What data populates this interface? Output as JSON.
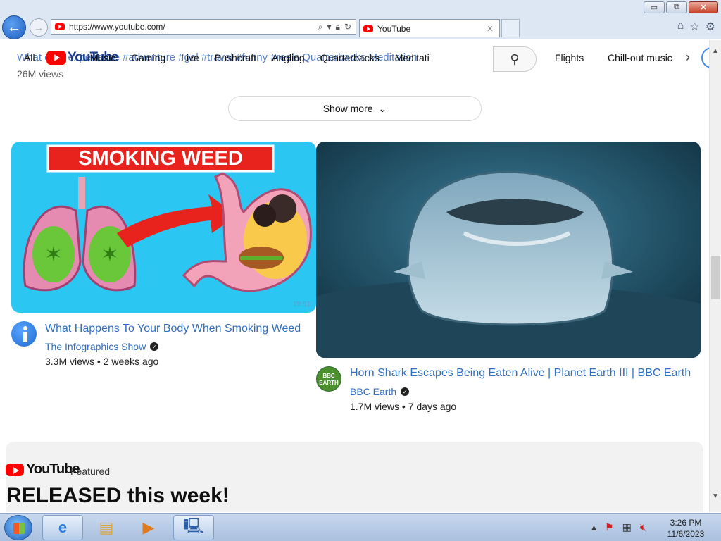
{
  "browser": {
    "url": "https://www.youtube.com/",
    "tab_title": "YouTube",
    "window_buttons": {
      "minimize": "▭",
      "restore": "⧉",
      "close": "✕"
    }
  },
  "header": {
    "logo_text": "YouTube",
    "overlap_text": "What   ever experience #adventure #gol #travel #funny #reels Quarterbacks Meditation",
    "chips": [
      "All",
      "Music",
      "Gaming",
      "Live",
      "Bushcraft",
      "Angling",
      "Quarterbacks",
      "Meditati"
    ],
    "chips_right": [
      "Flights",
      "Chill-out music"
    ],
    "views_top": "26M views"
  },
  "show_more": {
    "label": "Show more"
  },
  "videos": [
    {
      "thumb_text": "SMOKING WEED",
      "duration": "19:51",
      "title": "What Happens To Your Body When Smoking Weed",
      "channel": "The Infographics Show",
      "views": "3.3M views",
      "age": "2 weeks ago",
      "meta": "3.3M views • 2 weeks ago"
    },
    {
      "title": "Horn Shark Escapes Being Eaten Alive | Planet Earth III | BBC Earth",
      "channel": "BBC Earth",
      "channel_avatar_text": "BBC EARTH",
      "views": "1.7M views",
      "age": "7 days ago",
      "meta": "1.7M views • 7 days ago"
    }
  ],
  "featured": {
    "logo_text": "YouTube",
    "label": "Featured",
    "title": "RELEASED this week!"
  },
  "taskbar": {
    "time": "3:26 PM",
    "date": "11/6/2023"
  },
  "colors": {
    "youtube_red": "#ff0000",
    "link_blue": "#2f6fc0",
    "thumb1_bg": "#2cc6f2",
    "thumb2_bg": "#1f4a62"
  }
}
